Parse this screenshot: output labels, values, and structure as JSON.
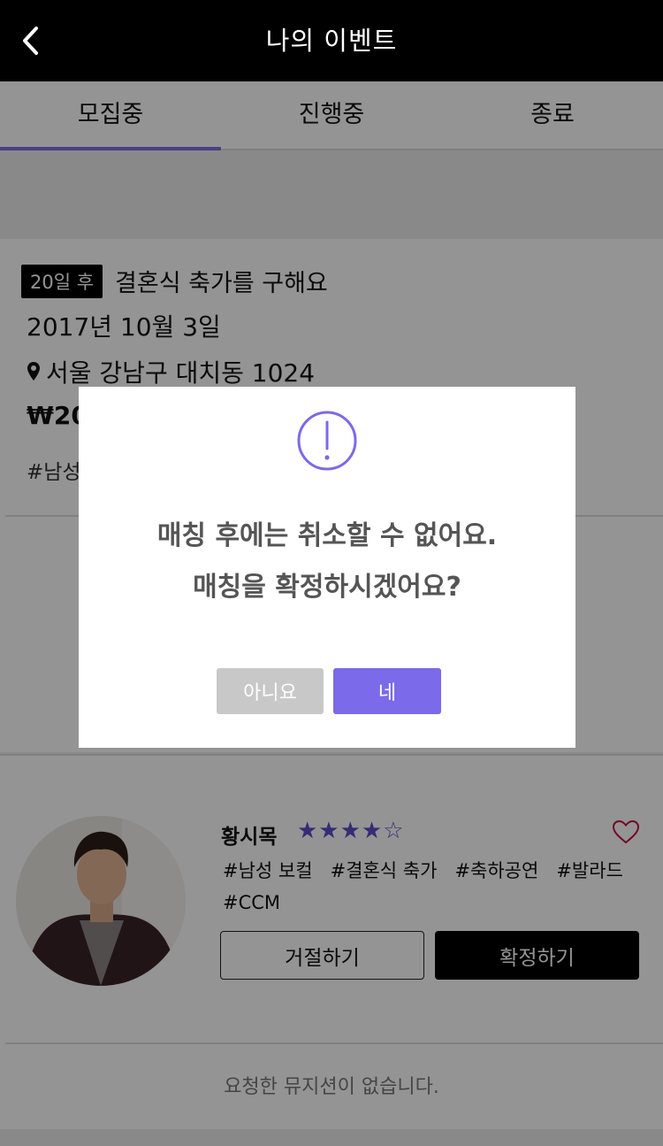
{
  "header": {
    "title": "나의 이벤트",
    "back_icon": "chevron-left-icon"
  },
  "tabs": [
    {
      "label": "모집중",
      "active": true
    },
    {
      "label": "진행중",
      "active": false
    },
    {
      "label": "종료",
      "active": false
    }
  ],
  "event": {
    "dday": "20일 후",
    "title": "결혼식 축가를 구해요",
    "date": "2017년 10월 3일",
    "location": "서울 강남구 대치동 1024",
    "price": "₩20",
    "tags": "#남성"
  },
  "musician": {
    "name": "황시목",
    "stars": "★★★★☆",
    "rating": 4,
    "tags": [
      "#남성 보컬",
      "#결혼식 축가",
      "#축하공연",
      "#발라드",
      "#CCM"
    ],
    "reject_label": "거절하기",
    "confirm_label": "확정하기"
  },
  "empty_message": "요청한 뮤지션이 없습니다.",
  "modal": {
    "line1": "매칭 후에는 취소할 수 없어요.",
    "line2": "매칭을 확정하시겠어요?",
    "no_label": "아니요",
    "yes_label": "네",
    "icon": "exclamation-circle-icon"
  },
  "colors": {
    "accent": "#7b6ae9",
    "star": "#5b4ec8",
    "heart": "#c0143c",
    "header_bg": "#000000"
  }
}
